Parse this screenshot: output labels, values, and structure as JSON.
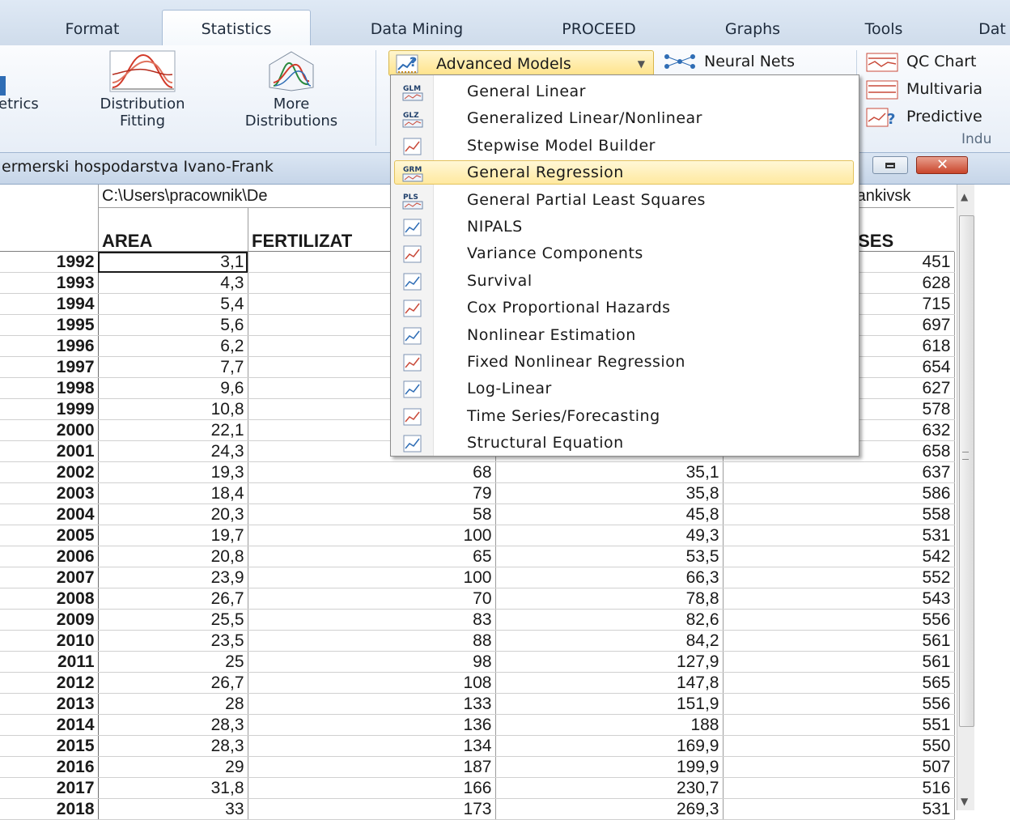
{
  "ribbon": {
    "tabs": [
      "Format",
      "Statistics",
      "Data Mining",
      "PROCEED",
      "Graphs",
      "Tools",
      "Dat"
    ],
    "active_tab": "Statistics",
    "left_cut_label": "etrics",
    "distribution_fitting": [
      "Distribution",
      "Fitting"
    ],
    "more_distributions": [
      "More",
      "Distributions"
    ],
    "advanced_models": "Advanced Models",
    "neural_nets": "Neural Nets",
    "qc_charts": "QC Chart",
    "multivariate": "Multivaria",
    "predictive": "Predictive",
    "group_label": "Indu"
  },
  "window": {
    "title": "ermerski hospodarstva Ivano-Frank",
    "path": "C:\\Users\\pracownik\\De",
    "path_tail": "rankivsk"
  },
  "menu": {
    "items": [
      {
        "badge": "GLM",
        "label": "General Linear"
      },
      {
        "badge": "GLZ",
        "label": "Generalized Linear/Nonlinear"
      },
      {
        "badge": "",
        "label": "Stepwise Model Builder"
      },
      {
        "badge": "GRM",
        "label": "General Regression"
      },
      {
        "badge": "PLS",
        "label": "General Partial Least Squares"
      },
      {
        "badge": "",
        "label": "NIPALS"
      },
      {
        "badge": "",
        "label": "Variance Components"
      },
      {
        "badge": "",
        "label": "Survival"
      },
      {
        "badge": "",
        "label": "Cox Proportional Hazards"
      },
      {
        "badge": "",
        "label": "Nonlinear Estimation"
      },
      {
        "badge": "",
        "label": "Fixed Nonlinear Regression"
      },
      {
        "badge": "",
        "label": "Log-Linear"
      },
      {
        "badge": "",
        "label": "Time Series/Forecasting"
      },
      {
        "badge": "",
        "label": "Structural Equation"
      }
    ],
    "highlighted_index": 3
  },
  "table": {
    "columns": [
      "AREA",
      "FERTILIZAT",
      "",
      "",
      "ISES"
    ],
    "rows": [
      [
        "1992",
        "3,1",
        "",
        "",
        "451"
      ],
      [
        "1993",
        "4,3",
        "",
        "",
        "628"
      ],
      [
        "1994",
        "5,4",
        "",
        "",
        "715"
      ],
      [
        "1995",
        "5,6",
        "",
        "",
        "697"
      ],
      [
        "1996",
        "6,2",
        "",
        "",
        "618"
      ],
      [
        "1997",
        "7,7",
        "",
        "",
        "654"
      ],
      [
        "1998",
        "9,6",
        "",
        "",
        "627"
      ],
      [
        "1999",
        "10,8",
        "",
        "",
        "578"
      ],
      [
        "2000",
        "22,1",
        "",
        "",
        "632"
      ],
      [
        "2001",
        "24,3",
        "",
        "",
        "658"
      ],
      [
        "2002",
        "19,3",
        "68",
        "35,1",
        "637"
      ],
      [
        "2003",
        "18,4",
        "79",
        "35,8",
        "586"
      ],
      [
        "2004",
        "20,3",
        "58",
        "45,8",
        "558"
      ],
      [
        "2005",
        "19,7",
        "100",
        "49,3",
        "531"
      ],
      [
        "2006",
        "20,8",
        "65",
        "53,5",
        "542"
      ],
      [
        "2007",
        "23,9",
        "100",
        "66,3",
        "552"
      ],
      [
        "2008",
        "26,7",
        "70",
        "78,8",
        "543"
      ],
      [
        "2009",
        "25,5",
        "83",
        "82,6",
        "556"
      ],
      [
        "2010",
        "23,5",
        "88",
        "84,2",
        "561"
      ],
      [
        "2011",
        "25",
        "98",
        "127,9",
        "561"
      ],
      [
        "2012",
        "26,7",
        "108",
        "147,8",
        "565"
      ],
      [
        "2013",
        "28",
        "133",
        "151,9",
        "556"
      ],
      [
        "2014",
        "28,3",
        "136",
        "188",
        "551"
      ],
      [
        "2015",
        "28,3",
        "134",
        "169,9",
        "550"
      ],
      [
        "2016",
        "29",
        "187",
        "199,9",
        "507"
      ],
      [
        "2017",
        "31,8",
        "166",
        "230,7",
        "516"
      ],
      [
        "2018",
        "33",
        "173",
        "269,3",
        "531"
      ]
    ]
  },
  "colors": {
    "accent": "#ffe38a",
    "ribbon": "#dfe9f5",
    "close": "#c9452b"
  }
}
